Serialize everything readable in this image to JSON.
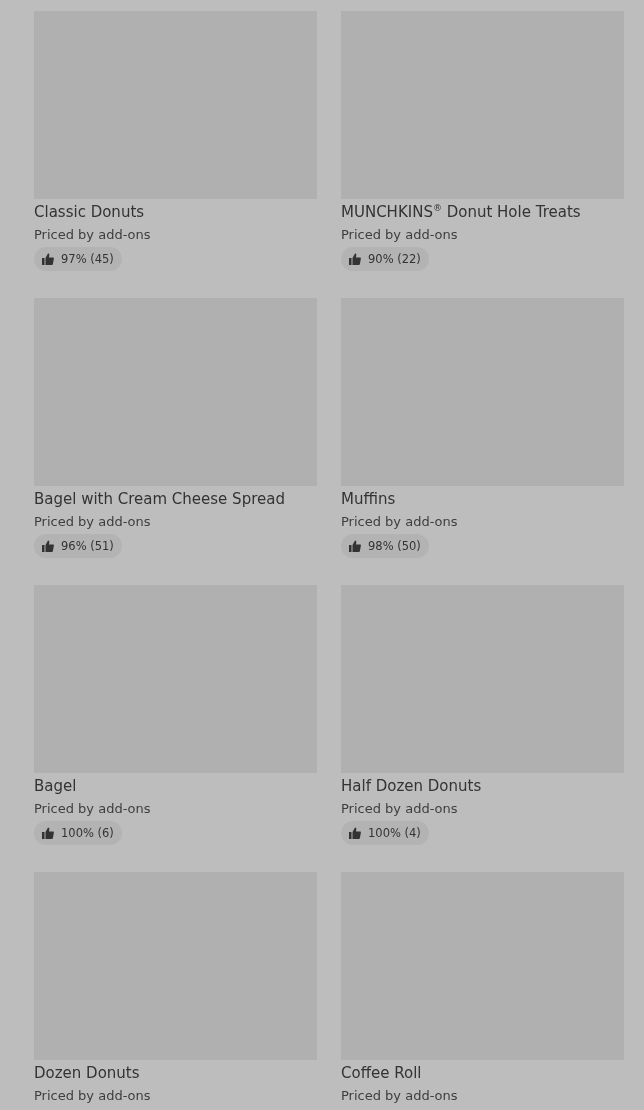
{
  "items": [
    {
      "title": "Classic Donuts",
      "subtitle": "Priced by add-ons",
      "rating": "97% (45)"
    },
    {
      "title": "MUNCHKINS$^{®}$ Donut Hole Treats",
      "subtitle": "Priced by add-ons",
      "rating": "90% (22)"
    },
    {
      "title": "Bagel with Cream Cheese Spread",
      "subtitle": "Priced by add-ons",
      "rating": "96% (51)"
    },
    {
      "title": "Muffins",
      "subtitle": "Priced by add-ons",
      "rating": "98% (50)"
    },
    {
      "title": "Bagel",
      "subtitle": "Priced by add-ons",
      "rating": "100% (6)"
    },
    {
      "title": "Half Dozen Donuts",
      "subtitle": "Priced by add-ons",
      "rating": "100% (4)"
    },
    {
      "title": "Dozen Donuts",
      "subtitle": "Priced by add-ons"
    },
    {
      "title": "Coffee Roll",
      "subtitle": "Priced by add-ons"
    }
  ]
}
